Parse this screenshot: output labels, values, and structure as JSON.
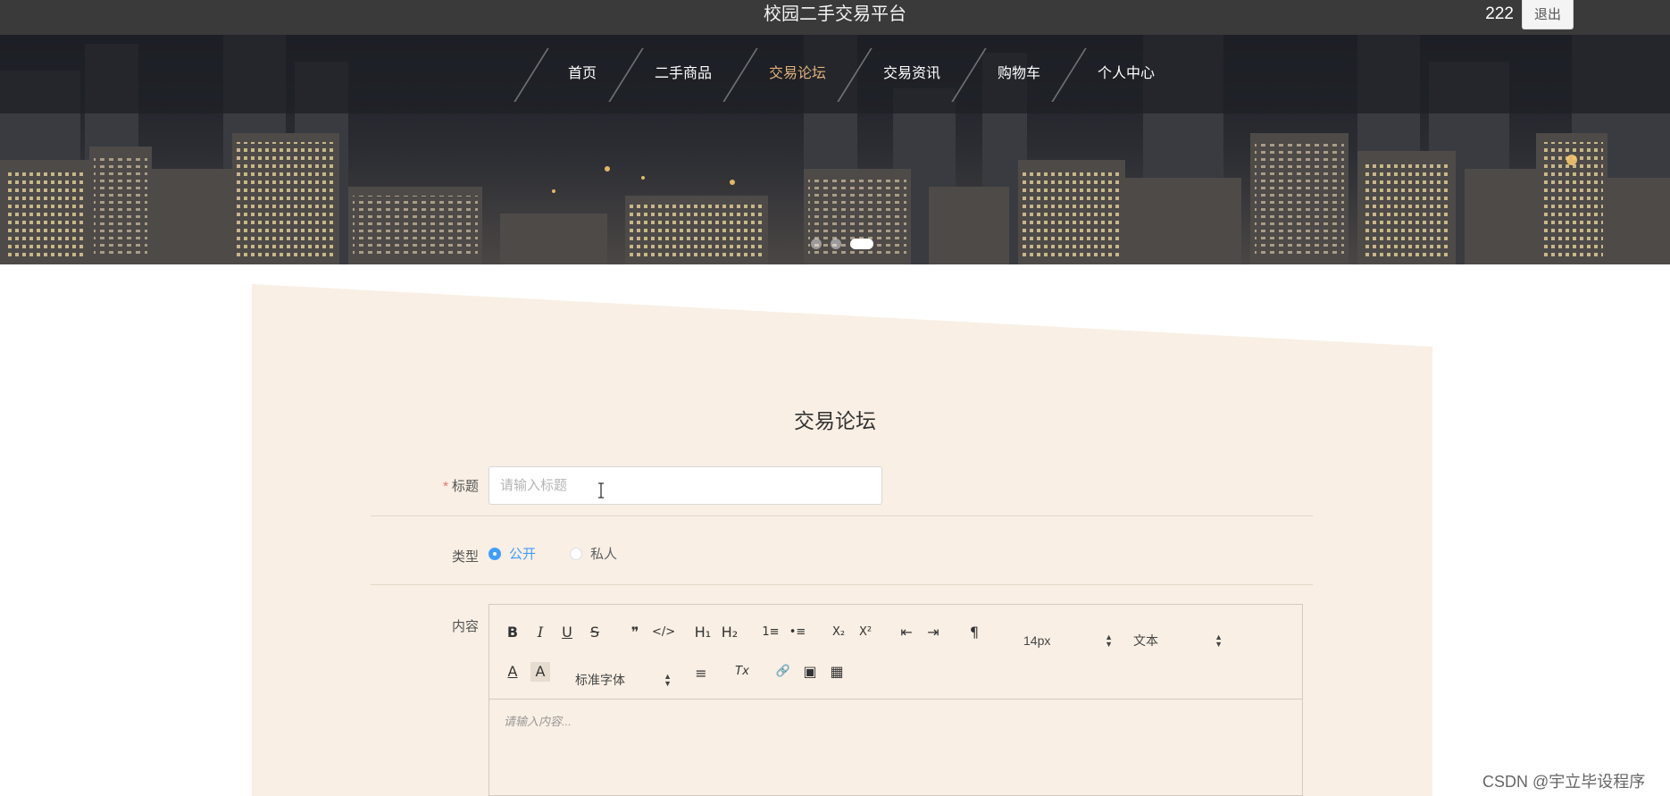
{
  "header": {
    "site_title": "校园二手交易平台",
    "username": "222",
    "logout_label": "退出"
  },
  "nav": {
    "items": [
      {
        "label": "首页",
        "active": false
      },
      {
        "label": "二手商品",
        "active": false
      },
      {
        "label": "交易论坛",
        "active": true
      },
      {
        "label": "交易资讯",
        "active": false
      },
      {
        "label": "购物车",
        "active": false
      },
      {
        "label": "个人中心",
        "active": false
      }
    ]
  },
  "carousel": {
    "slide_count": 3,
    "active_index": 2
  },
  "form": {
    "title": "交易论坛",
    "title_field": {
      "label": "标题",
      "required_mark": "*",
      "placeholder": "请输入标题",
      "value": ""
    },
    "type_field": {
      "label": "类型",
      "options": [
        {
          "label": "公开",
          "checked": true
        },
        {
          "label": "私人",
          "checked": false
        }
      ]
    },
    "content_field": {
      "label": "内容",
      "placeholder": "请输入内容...",
      "toolbar": {
        "bold": "B",
        "italic": "I",
        "underline": "U",
        "strike": "S",
        "blockquote": "❞",
        "code": "</>",
        "h1": "H₁",
        "h2": "H₂",
        "ordered_list": "1≡",
        "bullet_list": "•≡",
        "subscript": "X₂",
        "superscript": "X²",
        "outdent": "⇤",
        "indent": "⇥",
        "direction": "¶",
        "size_value": "14px",
        "header_value": "文本",
        "color": "A",
        "background": "A",
        "font_value": "标准字体",
        "align": "≡",
        "clean": "Tx",
        "link": "🔗",
        "image": "▣",
        "video": "▦"
      }
    }
  },
  "watermark": "CSDN @宇立毕设程序",
  "colors": {
    "topbar": "#3a3a3a",
    "nav_active": "#e0b07a",
    "panel": "#f9efe4",
    "radio_checked": "#409eff",
    "required": "#f56c6c"
  }
}
